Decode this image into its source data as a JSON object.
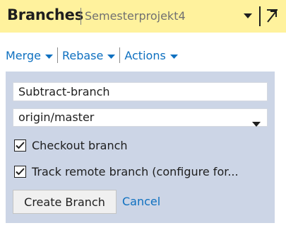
{
  "header": {
    "title": "Branches",
    "project": "Semesterprojekt4",
    "dropdown_icon": "chevron-down-icon",
    "pin_icon": "pin-icon"
  },
  "actions": {
    "merge": "Merge",
    "rebase": "Rebase",
    "actions": "Actions"
  },
  "form": {
    "branch_name": "Subtract-branch",
    "base_branch": "origin/master",
    "checkout_label": "Checkout branch",
    "checkout_checked": true,
    "track_label": "Track remote branch (configure for...",
    "track_checked": true,
    "create_button": "Create Branch",
    "cancel_link": "Cancel"
  },
  "colors": {
    "header_bg": "#fff29d",
    "link": "#0e70c0",
    "panel_bg": "#ccd5e6"
  }
}
